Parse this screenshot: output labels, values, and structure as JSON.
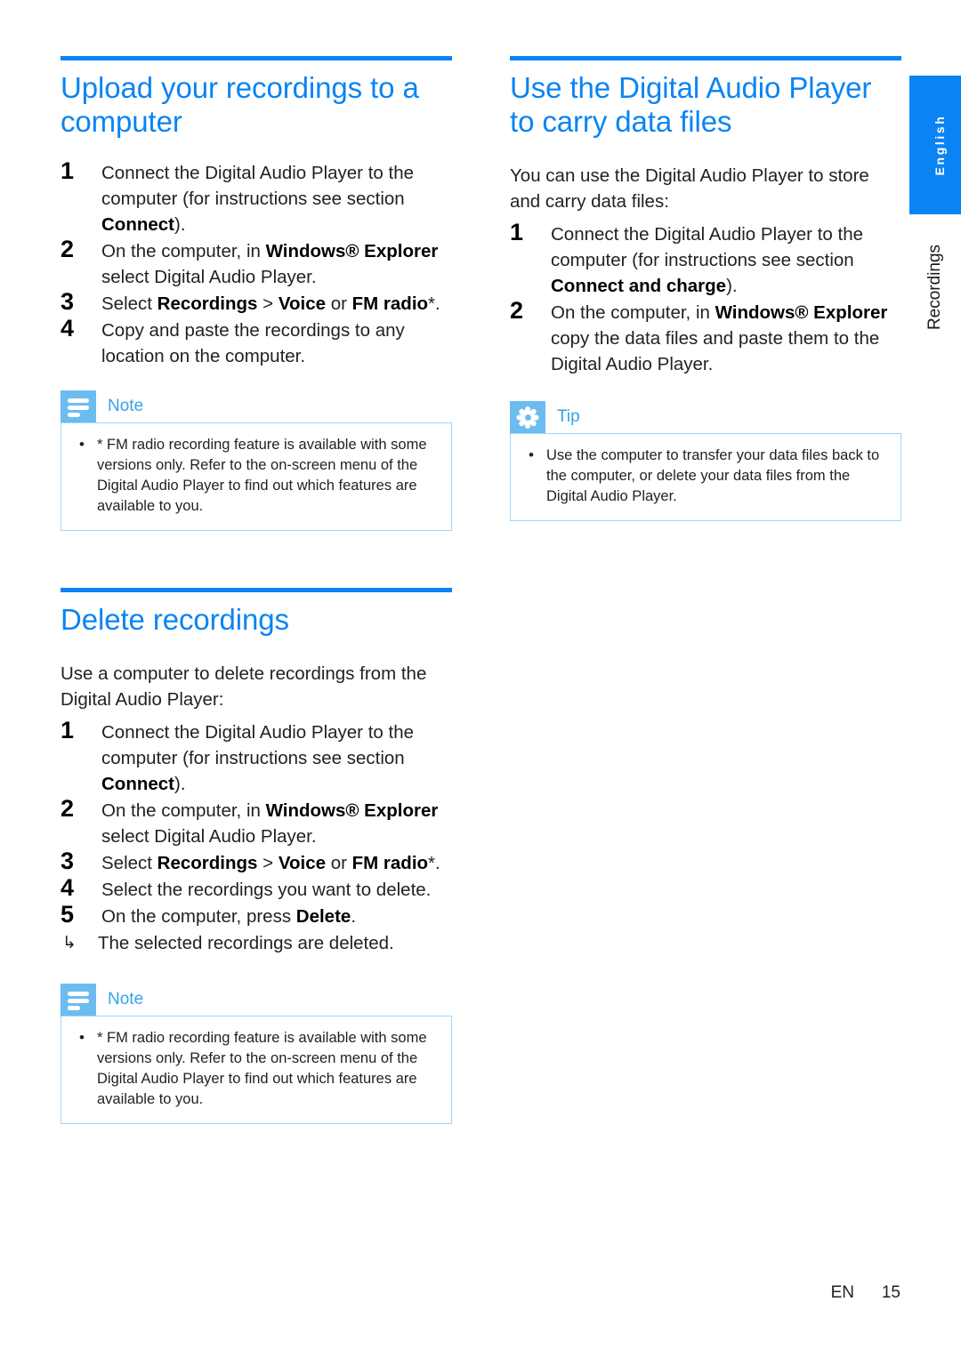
{
  "page": {
    "language_tab": "English",
    "chapter_tab": "Recordings",
    "footer": {
      "language_code": "EN",
      "page_number": "15"
    },
    "accent_color": "#0B84F3",
    "callout_badge_color": "#6CBCF0",
    "callout_border_color": "#9FD6F5"
  },
  "left_column": {
    "section1": {
      "title": "Upload your recordings to a computer",
      "steps": [
        {
          "num": "1",
          "parts": [
            {
              "text": "Connect the Digital Audio Player to the computer (for instructions see section ",
              "bold": false
            },
            {
              "text": "Connect",
              "bold": true
            },
            {
              "text": ").",
              "bold": false
            }
          ]
        },
        {
          "num": "2",
          "parts": [
            {
              "text": "On the computer, in ",
              "bold": false
            },
            {
              "text": "Windows® Explorer",
              "bold": true
            },
            {
              "text": " select Digital Audio Player.",
              "bold": false
            }
          ]
        },
        {
          "num": "3",
          "parts": [
            {
              "text": "Select ",
              "bold": false
            },
            {
              "text": "Recordings",
              "bold": true
            },
            {
              "text": " > ",
              "bold": false
            },
            {
              "text": "Voice",
              "bold": true
            },
            {
              "text": " or ",
              "bold": false
            },
            {
              "text": "FM radio",
              "bold": true
            },
            {
              "text": "*.",
              "bold": false
            }
          ]
        },
        {
          "num": "4",
          "parts": [
            {
              "text": "Copy and paste the recordings to any location on the computer.",
              "bold": false
            }
          ]
        }
      ],
      "callout": {
        "icon": "note-icon",
        "label": "Note",
        "items": [
          "* FM radio recording feature is available with some versions only. Refer to the on-screen menu of the Digital Audio Player to find out which features are available to you."
        ]
      }
    },
    "section2": {
      "title": "Delete recordings",
      "intro": "Use a computer to delete recordings from the Digital Audio Player:",
      "steps": [
        {
          "num": "1",
          "parts": [
            {
              "text": "Connect the Digital Audio Player to the computer (for instructions see section ",
              "bold": false
            },
            {
              "text": "Connect",
              "bold": true
            },
            {
              "text": ").",
              "bold": false
            }
          ]
        },
        {
          "num": "2",
          "parts": [
            {
              "text": "On the computer, in ",
              "bold": false
            },
            {
              "text": "Windows® Explorer",
              "bold": true
            },
            {
              "text": " select Digital Audio Player.",
              "bold": false
            }
          ]
        },
        {
          "num": "3",
          "parts": [
            {
              "text": "Select ",
              "bold": false
            },
            {
              "text": "Recordings",
              "bold": true
            },
            {
              "text": " > ",
              "bold": false
            },
            {
              "text": "Voice",
              "bold": true
            },
            {
              "text": " or ",
              "bold": false
            },
            {
              "text": "FM radio",
              "bold": true
            },
            {
              "text": "*.",
              "bold": false
            }
          ]
        },
        {
          "num": "4",
          "parts": [
            {
              "text": "Select the recordings you want to delete.",
              "bold": false
            }
          ]
        },
        {
          "num": "5",
          "parts": [
            {
              "text": "On the computer, press ",
              "bold": false
            },
            {
              "text": "Delete",
              "bold": true
            },
            {
              "text": ".",
              "bold": false
            }
          ]
        }
      ],
      "result": {
        "arrow": "↳",
        "text": "The selected recordings are deleted."
      },
      "callout": {
        "icon": "note-icon",
        "label": "Note",
        "items": [
          "* FM radio recording feature is available with some versions only. Refer to the on-screen menu of the Digital Audio Player to find out which features are available to you."
        ]
      }
    }
  },
  "right_column": {
    "section1": {
      "title": "Use the Digital Audio Player to carry data files",
      "intro": "You can use the Digital Audio Player to store and carry data files:",
      "steps": [
        {
          "num": "1",
          "parts": [
            {
              "text": "Connect the Digital Audio Player to the computer (for instructions see section ",
              "bold": false
            },
            {
              "text": "Connect and charge",
              "bold": true
            },
            {
              "text": ").",
              "bold": false
            }
          ]
        },
        {
          "num": "2",
          "parts": [
            {
              "text": "On the computer, in ",
              "bold": false
            },
            {
              "text": "Windows® Explorer",
              "bold": true
            },
            {
              "text": " copy the data files and paste them to the Digital Audio Player.",
              "bold": false
            }
          ]
        }
      ],
      "callout": {
        "icon": "tip-icon",
        "label": "Tip",
        "items": [
          "Use the computer to transfer your data files back to the computer, or delete your data files from the Digital Audio Player."
        ]
      }
    }
  }
}
